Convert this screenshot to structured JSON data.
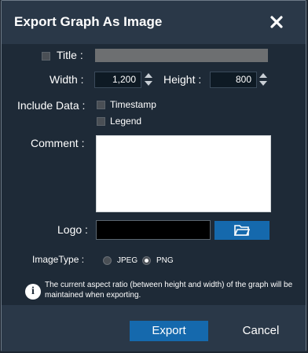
{
  "dialog": {
    "title": "Export Graph As Image",
    "close_icon": "close-x-icon"
  },
  "form": {
    "title_label": "Title :",
    "title_checked": false,
    "title_value": "",
    "width_label": "Width :",
    "width_value": "1,200",
    "height_label": "Height :",
    "height_value": "800",
    "include_data_label": "Include Data :",
    "timestamp_label": "Timestamp",
    "timestamp_checked": false,
    "legend_label": "Legend",
    "legend_checked": false,
    "comment_label": "Comment :",
    "comment_value": "",
    "logo_label": "Logo :",
    "logo_value": "",
    "folder_icon": "folder-open-icon",
    "image_type_label": "ImageType :",
    "image_types": [
      {
        "label": "JPEG",
        "selected": false
      },
      {
        "label": "PNG",
        "selected": true
      }
    ],
    "info_icon": "info-icon",
    "info_text": "The current aspect ratio (between height and width) of the graph will be maintained when exporting."
  },
  "footer": {
    "export_label": "Export",
    "cancel_label": "Cancel"
  },
  "colors": {
    "accent": "#1569ad",
    "background": "#1e2a37",
    "header": "#2a3848"
  }
}
